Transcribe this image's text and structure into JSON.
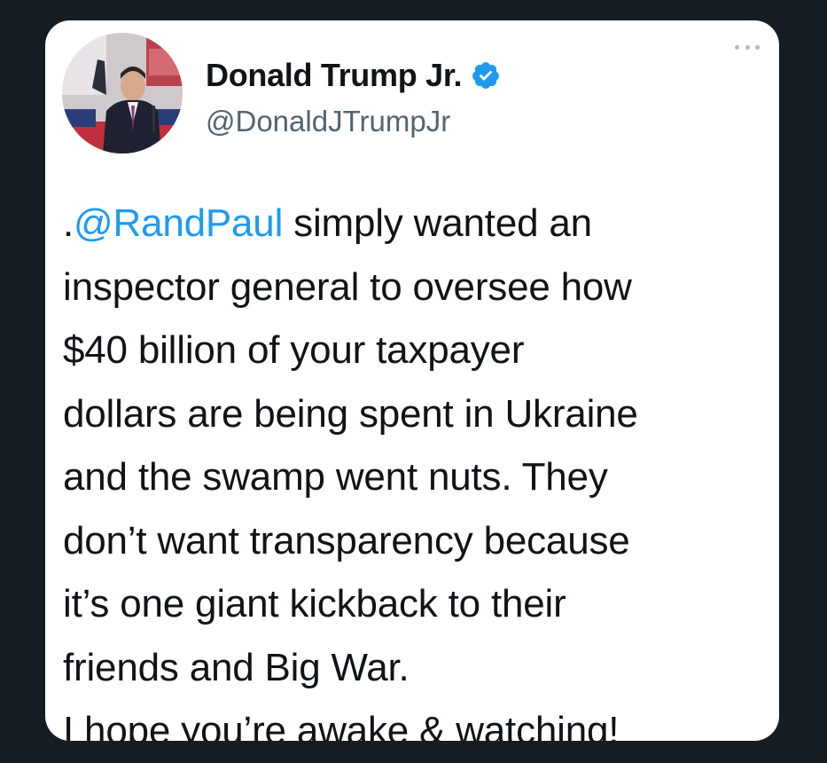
{
  "tweet": {
    "author": {
      "display_name": "Donald Trump Jr.",
      "handle": "@DonaldJTrumpJr",
      "verified": true,
      "verified_icon": "verified-badge-icon",
      "avatar_icon": "avatar"
    },
    "more_icon": "more-options-icon",
    "body": {
      "line1_prefix": ".",
      "line1_mention": "@RandPaul",
      "line1_rest": " simply wanted an",
      "line2": "inspector general to oversee how",
      "line3": "$40 billion of your taxpayer",
      "line4": "dollars are being spent in Ukraine",
      "line5": "and the swamp went nuts. They",
      "line6": "don’t want transparency because",
      "line7": "it’s one giant kickback to their",
      "line8": "friends and Big War.",
      "line9": "I hope you’re awake & watching!"
    }
  },
  "colors": {
    "background": "#151c24",
    "card": "#ffffff",
    "text": "#0f1419",
    "handle": "#536471",
    "accent": "#1d9bf0"
  }
}
